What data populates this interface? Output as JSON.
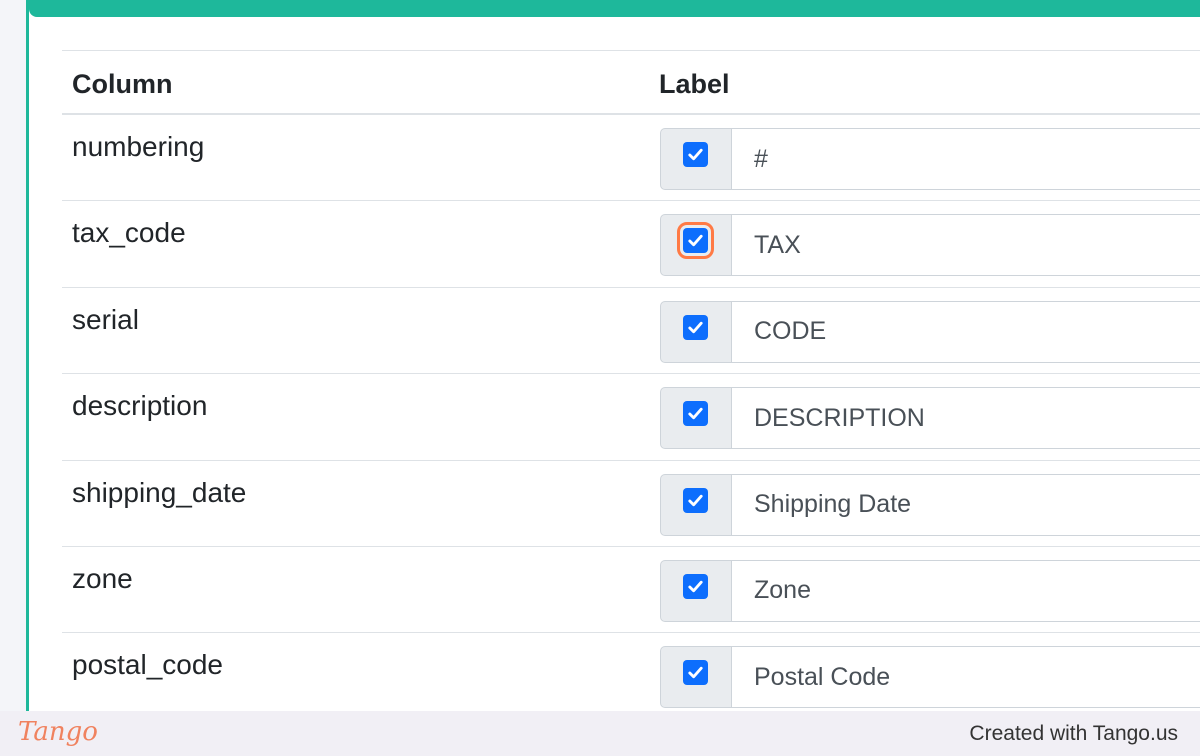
{
  "table": {
    "headers": {
      "column": "Column",
      "label": "Label"
    },
    "rows": [
      {
        "column": "numbering",
        "checked": true,
        "label": "#"
      },
      {
        "column": "tax_code",
        "checked": true,
        "label": "TAX"
      },
      {
        "column": "serial",
        "checked": true,
        "label": "CODE"
      },
      {
        "column": "description",
        "checked": true,
        "label": "DESCRIPTION"
      },
      {
        "column": "shipping_date",
        "checked": true,
        "label": "Shipping Date"
      },
      {
        "column": "zone",
        "checked": true,
        "label": "Zone"
      },
      {
        "column": "postal_code",
        "checked": true,
        "label": "Postal Code"
      }
    ]
  },
  "footer": {
    "logo": "Tango",
    "credit": "Created with Tango.us"
  },
  "colors": {
    "accent": "#1eb89b",
    "checkbox": "#0d6efd",
    "highlight": "#ff7a45"
  }
}
